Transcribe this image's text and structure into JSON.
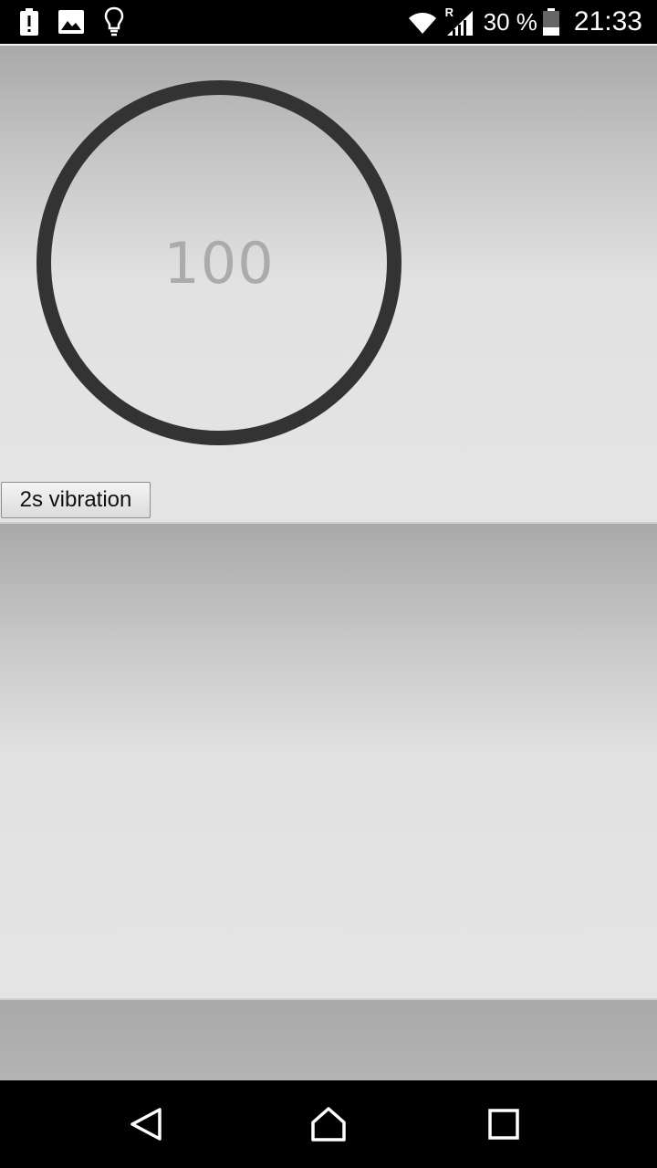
{
  "status_bar": {
    "battery_percent": "30 %",
    "time": "21:33",
    "left_icons": [
      "battery-alert-icon",
      "image-icon",
      "lightbulb-icon"
    ],
    "right_icons": [
      "wifi-icon",
      "signal-roaming-icon",
      "battery-icon"
    ],
    "roaming_label": "R"
  },
  "main": {
    "counter_value": "100",
    "vibrate_button_label": "2s vibration",
    "ring_color": "#333333",
    "text_color": "#ababab"
  },
  "nav_bar": {
    "icons": [
      "back-icon",
      "home-icon",
      "recents-icon"
    ]
  }
}
